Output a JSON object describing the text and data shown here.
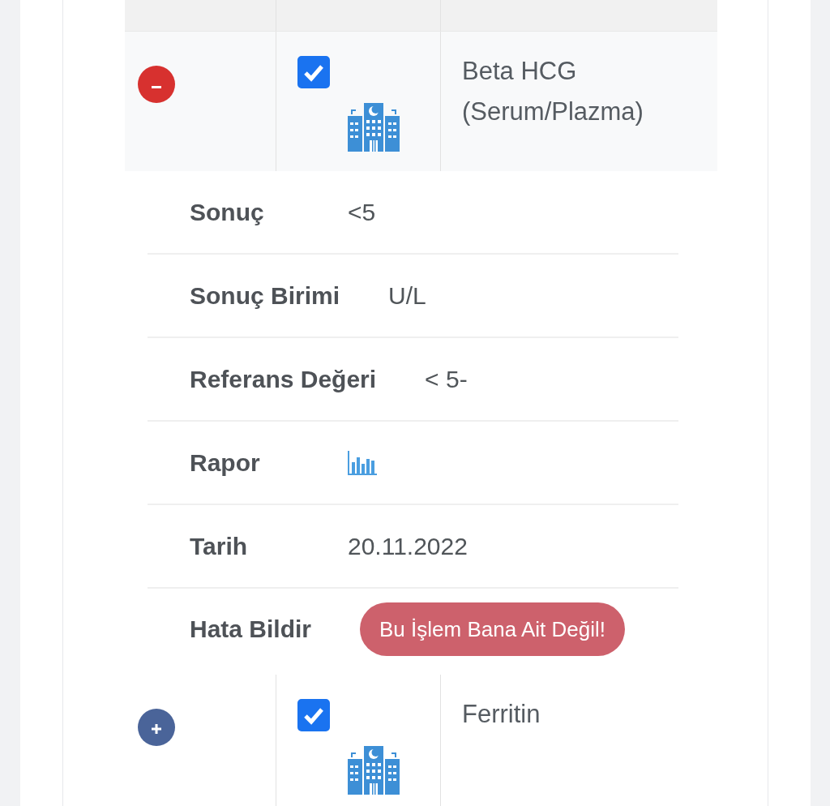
{
  "rows": [
    {
      "expanded": true,
      "checked": true,
      "name": "Beta HCG (Serum/Plazma)",
      "details": [
        {
          "kind": "text",
          "label": "Sonuç",
          "value": "<5"
        },
        {
          "kind": "text",
          "label": "Sonuç Birimi",
          "value": "U/L"
        },
        {
          "kind": "text",
          "label": "Referans Değeri",
          "value": "< 5-"
        },
        {
          "kind": "chart-link",
          "label": "Rapor"
        },
        {
          "kind": "text",
          "label": "Tarih",
          "value": "20.11.2022"
        },
        {
          "kind": "button",
          "label": "Hata Bildir",
          "value": "Bu İşlem Bana Ait Değil!"
        }
      ]
    },
    {
      "expanded": false,
      "checked": true,
      "name": "Ferritin"
    }
  ]
}
